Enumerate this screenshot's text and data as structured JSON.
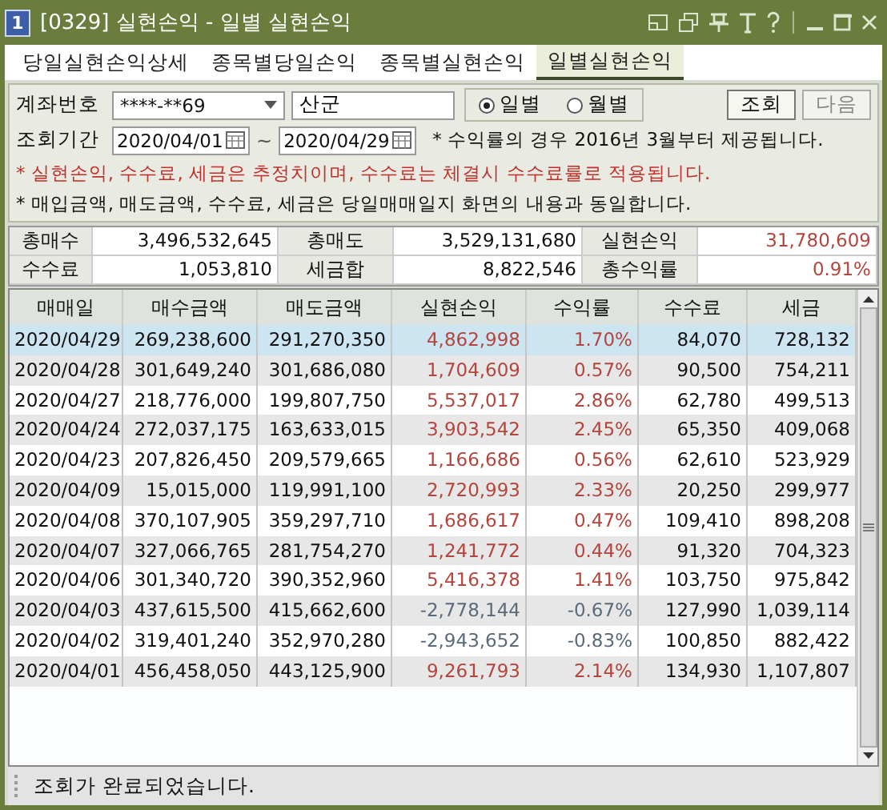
{
  "window": {
    "badge": "1",
    "title": "[0329] 실현손익 - 일별 실현손익"
  },
  "tabs": [
    {
      "label": "당일실현손익상세",
      "selected": false
    },
    {
      "label": "종목별당일손익",
      "selected": false
    },
    {
      "label": "종목별실현손익",
      "selected": false
    },
    {
      "label": "일별실현손익",
      "selected": true
    }
  ],
  "form": {
    "account_label": "계좌번호",
    "account": "****-**69",
    "account_name": "산군",
    "period_options": [
      {
        "label": "일별",
        "selected": true
      },
      {
        "label": "월별",
        "selected": false
      }
    ],
    "buttons": [
      "조회",
      "다음"
    ],
    "period_label": "조회기간",
    "date_from": "2020/04/01",
    "tilde": "~",
    "date_to": "2020/04/29",
    "note": "* 수익률의 경우 2016년 3월부터 제공됩니다.",
    "warning": "* 실현손익, 수수료, 세금은 추정치이며, 수수료는 체결시 수수료률로 적용됩니다.",
    "info": "* 매입금액, 매도금액, 수수료, 세금은 당일매매일지 화면의 내용과 동일합니다."
  },
  "summary": [
    [
      {
        "label": "총매수",
        "value": "3,496,532,645",
        "highlight": false
      },
      {
        "label": "총매도",
        "value": "3,529,131,680",
        "highlight": false
      },
      {
        "label": "실현손익",
        "value": "31,780,609",
        "highlight": true
      }
    ],
    [
      {
        "label": "수수료",
        "value": "1,053,810",
        "highlight": false
      },
      {
        "label": "세금합",
        "value": "8,822,546",
        "highlight": false
      },
      {
        "label": "총수익률",
        "value": "0.91%",
        "highlight": true
      }
    ]
  ],
  "table": {
    "columns": [
      "매매일",
      "매수금액",
      "매도금액",
      "실현손익",
      "수익률",
      "수수료",
      "세금"
    ],
    "rows": [
      {
        "cells": [
          "2020/04/29",
          "269,238,600",
          "291,270,350",
          "4,862,998",
          "1.70%",
          "84,070",
          "728,132"
        ],
        "negative": false,
        "selected": true
      },
      {
        "cells": [
          "2020/04/28",
          "301,649,240",
          "301,686,080",
          "1,704,609",
          "0.57%",
          "90,500",
          "754,211"
        ],
        "negative": false,
        "selected": false
      },
      {
        "cells": [
          "2020/04/27",
          "218,776,000",
          "199,807,750",
          "5,537,017",
          "2.86%",
          "62,780",
          "499,513"
        ],
        "negative": false,
        "selected": false
      },
      {
        "cells": [
          "2020/04/24",
          "272,037,175",
          "163,633,015",
          "3,903,542",
          "2.45%",
          "65,350",
          "409,068"
        ],
        "negative": false,
        "selected": false
      },
      {
        "cells": [
          "2020/04/23",
          "207,826,450",
          "209,579,665",
          "1,166,686",
          "0.56%",
          "62,610",
          "523,929"
        ],
        "negative": false,
        "selected": false
      },
      {
        "cells": [
          "2020/04/09",
          "15,015,000",
          "119,991,100",
          "2,720,993",
          "2.33%",
          "20,250",
          "299,977"
        ],
        "negative": false,
        "selected": false
      },
      {
        "cells": [
          "2020/04/08",
          "370,107,905",
          "359,297,710",
          "1,686,617",
          "0.47%",
          "109,410",
          "898,208"
        ],
        "negative": false,
        "selected": false
      },
      {
        "cells": [
          "2020/04/07",
          "327,066,765",
          "281,754,270",
          "1,241,772",
          "0.44%",
          "91,320",
          "704,323"
        ],
        "negative": false,
        "selected": false
      },
      {
        "cells": [
          "2020/04/06",
          "301,340,720",
          "390,352,960",
          "5,416,378",
          "1.41%",
          "103,750",
          "975,842"
        ],
        "negative": false,
        "selected": false
      },
      {
        "cells": [
          "2020/04/03",
          "437,615,500",
          "415,662,600",
          "-2,778,144",
          "-0.67%",
          "127,990",
          "1,039,114"
        ],
        "negative": true,
        "selected": false
      },
      {
        "cells": [
          "2020/04/02",
          "319,401,240",
          "352,970,280",
          "-2,943,652",
          "-0.83%",
          "100,850",
          "882,422"
        ],
        "negative": true,
        "selected": false
      },
      {
        "cells": [
          "2020/04/01",
          "456,458,050",
          "443,125,900",
          "9,261,793",
          "2.14%",
          "134,930",
          "1,107,807"
        ],
        "negative": false,
        "selected": false
      }
    ]
  },
  "status_bar": "조회가 완료되었습니다."
}
